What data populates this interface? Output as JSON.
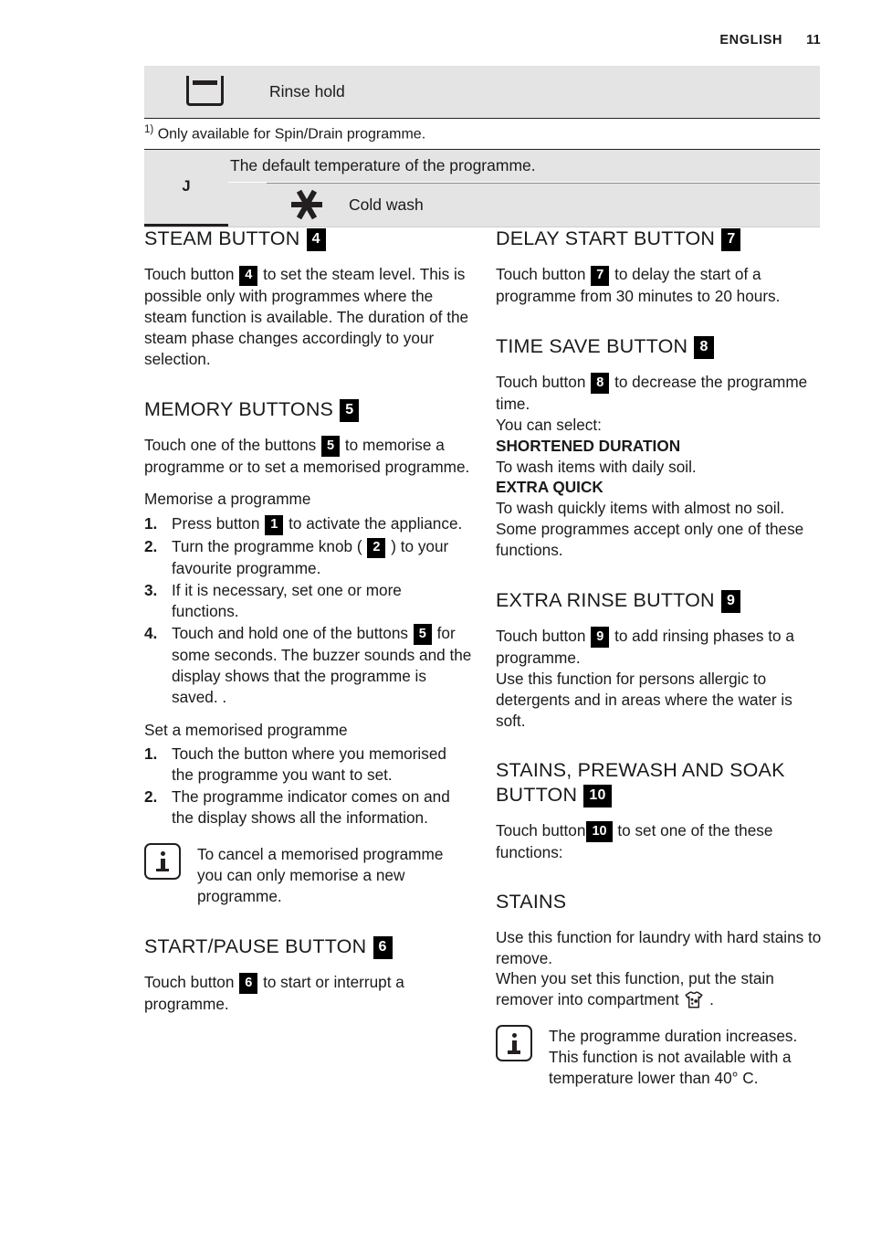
{
  "header": {
    "language": "ENGLISH",
    "page_number": "11"
  },
  "table": {
    "rinse_hold": {
      "icon": "tub-icon",
      "label": "Rinse hold"
    },
    "footnote": {
      "marker": "1)",
      "text": "Only available for Spin/Drain programme."
    },
    "temperature_group": {
      "symbol": "J",
      "default_text": "The default temperature of the programme.",
      "cold_wash": {
        "icon": "asterisk-icon",
        "label": "Cold wash"
      }
    }
  },
  "left_column": {
    "steam": {
      "title": "STEAM BUTTON",
      "title_badge": "4",
      "body_prefix": "Touch button",
      "body_badge": "4",
      "body_suffix": "to set the steam level. This is possible only with programmes where the steam function is available. The duration of the steam phase changes accordingly to your selection."
    },
    "memory": {
      "title": "MEMORY BUTTONS",
      "title_badge": "5",
      "intro_prefix": "Touch one of the buttons",
      "intro_badge": "5",
      "intro_suffix": "to memorise a programme or to set a memorised programme.",
      "memorise_label": "Memorise a programme",
      "memorise_steps": [
        {
          "num": "1.",
          "prefix": "Press button",
          "badge": "1",
          "suffix": "to activate the appliance."
        },
        {
          "num": "2.",
          "prefix": "Turn the programme knob (",
          "badge": "2",
          "suffix": ") to your favourite programme."
        },
        {
          "num": "3.",
          "prefix": "If it is necessary, set one or more functions.",
          "badge": "",
          "suffix": ""
        },
        {
          "num": "4.",
          "prefix": "Touch and hold one of the buttons",
          "badge": "5",
          "suffix": "for some seconds. The buzzer sounds and the display shows that the programme is saved. ."
        }
      ],
      "set_label": "Set a memorised programme",
      "set_steps": [
        {
          "num": "1.",
          "prefix": "Touch the button where you memorised the programme you want to set.",
          "badge": "",
          "suffix": ""
        },
        {
          "num": "2.",
          "prefix": "The programme indicator comes on and the display shows all the information.",
          "badge": "",
          "suffix": ""
        }
      ],
      "note": "To cancel a memorised programme you can only memorise a new programme."
    },
    "start_pause": {
      "title": "START/PAUSE BUTTON",
      "title_badge": "6",
      "body_prefix": "Touch button",
      "body_badge": "6",
      "body_suffix": "to start or interrupt a programme."
    }
  },
  "right_column": {
    "delay_start": {
      "title": "DELAY START BUTTON",
      "title_badge": "7",
      "body_prefix": "Touch button",
      "body_badge": "7",
      "body_suffix": "to delay the start of a programme from 30 minutes to 20 hours."
    },
    "time_save": {
      "title": "TIME SAVE BUTTON",
      "title_badge": "8",
      "body_prefix": "Touch button",
      "body_badge": "8",
      "body_suffix": "to decrease the programme time.",
      "select_line": "You can select:",
      "option_1_title": "SHORTENED DURATION",
      "option_1_text": "To wash items with daily soil.",
      "option_2_title": "EXTRA QUICK",
      "option_2_text": "To wash quickly items with almost no soil.",
      "closing": "Some programmes accept only one of these functions."
    },
    "extra_rinse": {
      "title": "EXTRA RINSE BUTTON",
      "title_badge": "9",
      "body_prefix": "Touch button",
      "body_badge": "9",
      "body_suffix": "to add rinsing phases to a programme.",
      "extra_line": "Use this function for persons allergic to detergents and in areas where the water is soft."
    },
    "stains_prewash_soak": {
      "title": "STAINS, PREWASH AND SOAK BUTTON",
      "title_badge": "10",
      "body_prefix": "Touch button",
      "body_badge": "10",
      "body_suffix": "to set one of the these functions:"
    },
    "stains": {
      "title": "STAINS",
      "line_1": "Use this function for laundry with hard stains to remove.",
      "line_2_prefix": "When you set this function, put the stain remover into compartment",
      "line_2_icon": "shirt-stain-icon",
      "line_2_suffix": ".",
      "note": "The programme duration increases. This function is not available with a temperature lower than 40° C."
    }
  }
}
